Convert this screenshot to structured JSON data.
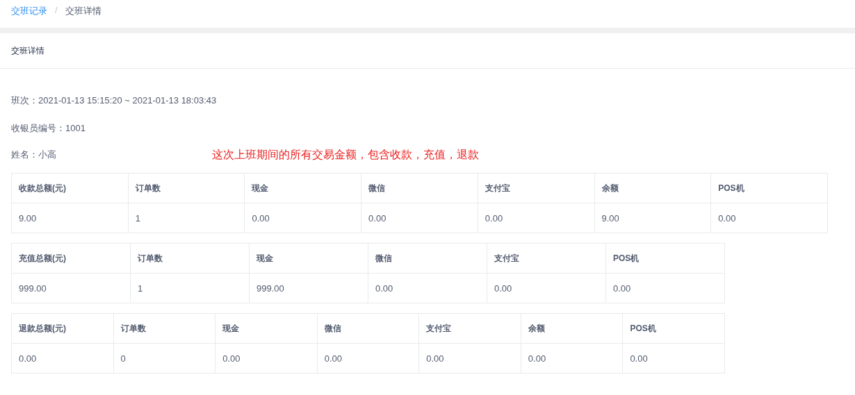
{
  "breadcrumb": [
    {
      "label": "交班记录",
      "kind": "link"
    },
    {
      "label": "/",
      "kind": "separator"
    },
    {
      "label": "交班详情",
      "kind": "current"
    }
  ],
  "card": {
    "title": "交班详情",
    "info": [
      {
        "label": "班次：",
        "value": "2021-01-13 15:15:20 ~ 2021-01-13 18:03:43"
      },
      {
        "label": "收银员编号：",
        "value": "1001"
      },
      {
        "label": "姓名：",
        "value": "小高"
      }
    ],
    "annotation": "这次上班期间的所有交易金额，包含收款，充值，退款",
    "tables": [
      {
        "columns": [
          "收款总额(元)",
          "订单数",
          "现金",
          "微信",
          "支付宝",
          "余额",
          "POS机"
        ],
        "row": [
          "9.00",
          "1",
          "0.00",
          "0.00",
          "0.00",
          "9.00",
          "0.00"
        ]
      },
      {
        "columns": [
          "充值总额(元)",
          "订单数",
          "现金",
          "微信",
          "支付宝",
          "POS机"
        ],
        "row": [
          "999.00",
          "1",
          "999.00",
          "0.00",
          "0.00",
          "0.00"
        ]
      },
      {
        "columns": [
          "退款总额(元)",
          "订单数",
          "现金",
          "微信",
          "支付宝",
          "余额",
          "POS机"
        ],
        "row": [
          "0.00",
          "0",
          "0.00",
          "0.00",
          "0.00",
          "0.00",
          "0.00"
        ]
      }
    ]
  }
}
